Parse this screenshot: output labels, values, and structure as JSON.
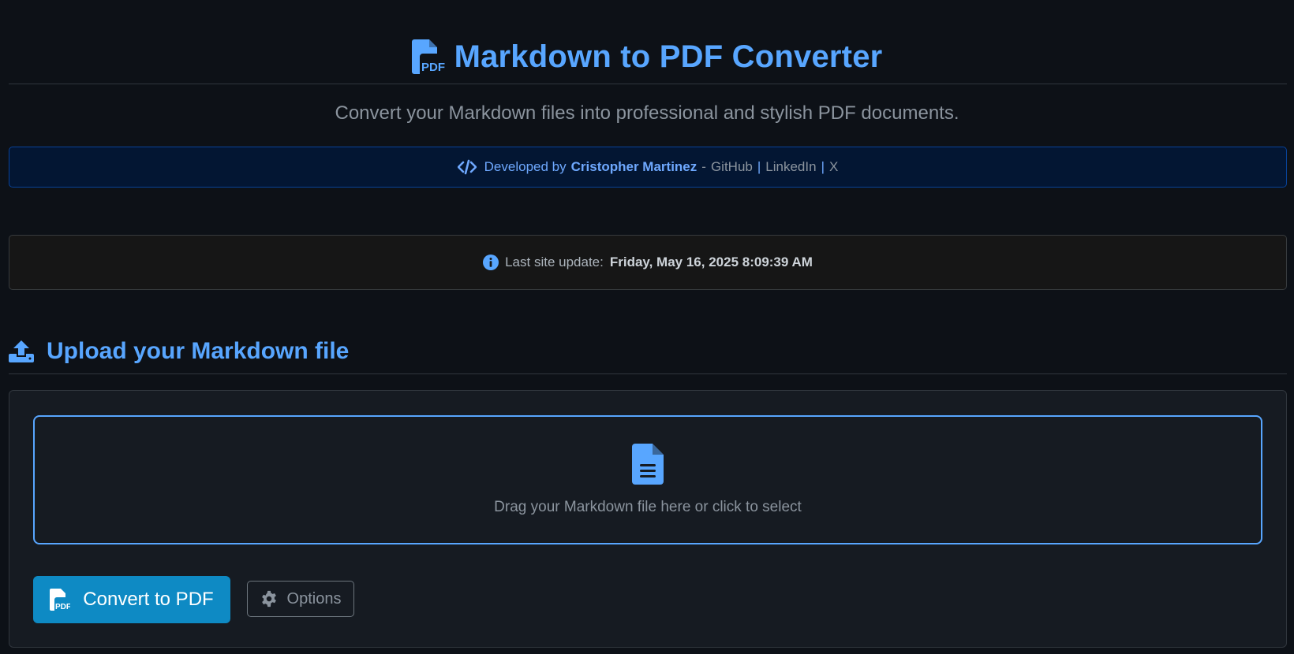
{
  "header": {
    "title": "Markdown to PDF Converter",
    "subtitle": "Convert your Markdown files into professional and stylish PDF documents.",
    "title_icon": "file-pdf-icon"
  },
  "developer_banner": {
    "icon": "code-icon",
    "prefix": "Developed by",
    "name": "Cristopher Martinez",
    "dash": "-",
    "links": [
      "GitHub",
      "LinkedIn",
      "X"
    ],
    "separator": "|"
  },
  "update": {
    "icon": "info-circle-icon",
    "label": "Last site update:",
    "value": "Friday, May 16, 2025 8:09:39 AM"
  },
  "upload": {
    "icon": "upload-icon",
    "heading": "Upload your Markdown file",
    "dropzone_icon": "file-text-icon",
    "dropzone_text": "Drag your Markdown file here or click to select",
    "convert_label": "Convert to PDF",
    "convert_icon": "file-pdf-icon",
    "options_label": "Options",
    "options_icon": "gear-icon"
  },
  "colors": {
    "background": "#0d1117",
    "accent": "#58a6ff",
    "banner_bg": "#031633",
    "convert_button": "#0e8ac4"
  }
}
